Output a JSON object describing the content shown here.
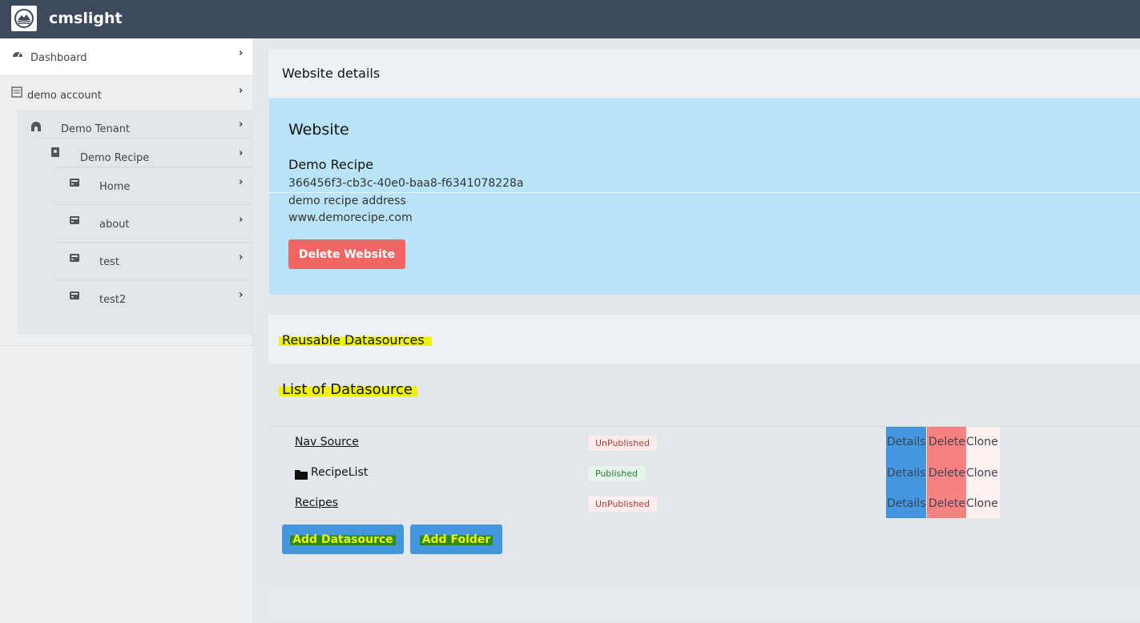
{
  "app": {
    "title": "cmslight"
  },
  "sidebar": {
    "dashboard": "Dashboard",
    "account": "demo account",
    "tenant": "Demo Tenant",
    "recipe": "Demo Recipe",
    "pages": [
      "Home",
      "about",
      "test",
      "test2"
    ]
  },
  "website_details": {
    "header": "Website details",
    "panel_title": "Website",
    "name": "Demo Recipe",
    "id": "366456f3-cb3c-40e0-baa8-f6341078228a",
    "address": "demo recipe address",
    "url": "www.demorecipe.com",
    "delete_label": "Delete Website"
  },
  "reusable": {
    "header": "Reusable Datasources"
  },
  "datasources": {
    "title": "List of Datasource",
    "rows": [
      {
        "name": "Nav Source",
        "status": "UnPublished"
      },
      {
        "name": "RecipeList",
        "status": "Published"
      },
      {
        "name": "Recipes",
        "status": "UnPublished"
      }
    ],
    "actions": {
      "details": "Details",
      "delete": "Delete",
      "clone": "Clone"
    },
    "add_datasource_label": "Add Datasource",
    "add_folder_label": "Add Folder"
  },
  "colors": {
    "topbar": "#3d4a5e",
    "website_panel": "#b9e4f8",
    "danger": "#f26565",
    "primary": "#4496df",
    "highlight": "#eef205"
  }
}
